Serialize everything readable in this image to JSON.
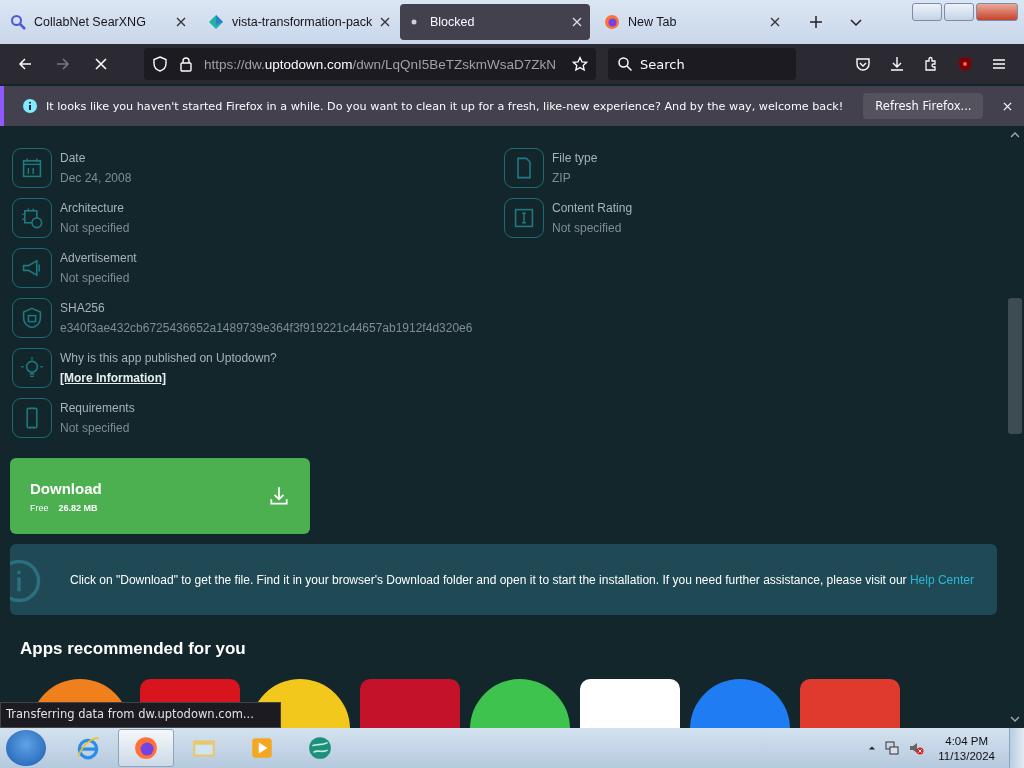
{
  "tabs": [
    {
      "label": "CollabNet SearXNG",
      "kind": "search",
      "selected": false
    },
    {
      "label": "vista-transformation-pack",
      "kind": "site",
      "selected": false
    },
    {
      "label": "Blocked",
      "kind": "dot",
      "selected": true
    },
    {
      "label": "New Tab",
      "kind": "firefox",
      "selected": false
    }
  ],
  "toolbar": {
    "url_scheme": "https://dw.",
    "url_host": "uptodown.com",
    "url_path": "/dwn/LqQnI5BeTZskmWsaD7ZkN",
    "search_placeholder": "Search"
  },
  "notification": {
    "text": "It looks like you haven't started Firefox in a while. Do you want to clean it up for a fresh, like-new experience? And by the way, welcome back!",
    "button": "Refresh Firefox..."
  },
  "details_left": [
    {
      "kind": "calendar",
      "label": "Date",
      "value": "Dec 24, 2008",
      "link": false
    },
    {
      "kind": "chip",
      "label": "Architecture",
      "value": "Not specified",
      "link": false
    },
    {
      "kind": "megaphone",
      "label": "Advertisement",
      "value": "Not specified",
      "link": false
    },
    {
      "kind": "shield",
      "label": "SHA256",
      "value": "e340f3ae432cb6725436652a1489739e364f3f919221c44657ab1912f4d320e6",
      "link": false
    },
    {
      "kind": "bulb",
      "label": "Why is this app published on Uptodown?",
      "value": "[More Information]",
      "link": true
    },
    {
      "kind": "phone",
      "label": "Requirements",
      "value": "Not specified",
      "link": false
    }
  ],
  "details_right": [
    {
      "kind": "file",
      "label": "File type",
      "value": "ZIP",
      "link": false
    },
    {
      "kind": "rating",
      "label": "Content Rating",
      "value": "Not specified",
      "link": false
    }
  ],
  "download": {
    "title": "Download",
    "price": "Free",
    "size": "26.82 MB"
  },
  "info": {
    "text": "Click on \"Download\" to get the file. Find it in your browser's Download folder and open it to start the installation. If you need further assistance, please visit our",
    "link": "Help Center"
  },
  "recommended": {
    "heading": "Apps recommended for you",
    "apps": [
      {
        "color": "#f0801e"
      },
      {
        "color": "#d8141e"
      },
      {
        "color": "#f2c81c"
      },
      {
        "color": "#c3122a"
      },
      {
        "color": "#3fc34f"
      },
      {
        "color": "#ffffff"
      },
      {
        "color": "#1f7cf2"
      },
      {
        "color": "#e03a2e"
      }
    ]
  },
  "status": "Transferring data from dw.uptodown.com...",
  "taskbar": {
    "apps": [
      {
        "kind": "ie",
        "selected": false
      },
      {
        "kind": "firefox",
        "selected": true
      },
      {
        "kind": "folder",
        "selected": false
      },
      {
        "kind": "media",
        "selected": false
      },
      {
        "kind": "globe",
        "selected": false
      }
    ],
    "time": "4:04 PM",
    "date": "11/13/2024"
  }
}
